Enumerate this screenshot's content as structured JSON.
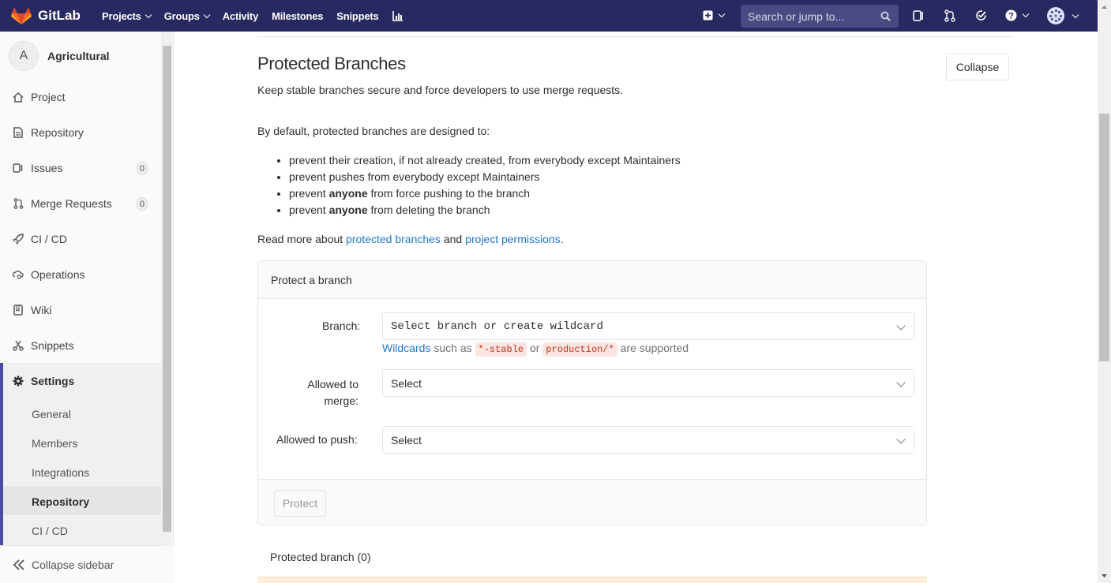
{
  "topnav": {
    "brand": "GitLab",
    "items": [
      {
        "label": "Projects",
        "caret": true
      },
      {
        "label": "Groups",
        "caret": true
      },
      {
        "label": "Activity",
        "caret": false
      },
      {
        "label": "Milestones",
        "caret": false
      },
      {
        "label": "Snippets",
        "caret": false
      }
    ],
    "search_placeholder": "Search or jump to...",
    "bg_color": "#292961"
  },
  "sidebar": {
    "project_initial": "A",
    "project_name": "Agricultural",
    "items": [
      {
        "label": "Project",
        "icon": "home-icon"
      },
      {
        "label": "Repository",
        "icon": "doc-icon"
      },
      {
        "label": "Issues",
        "icon": "issues-icon",
        "badge": "0"
      },
      {
        "label": "Merge Requests",
        "icon": "merge-request-icon",
        "badge": "0"
      },
      {
        "label": "CI / CD",
        "icon": "rocket-icon"
      },
      {
        "label": "Operations",
        "icon": "cloud-gear-icon"
      },
      {
        "label": "Wiki",
        "icon": "book-icon"
      },
      {
        "label": "Snippets",
        "icon": "scissors-icon"
      },
      {
        "label": "Settings",
        "icon": "gear-icon"
      }
    ],
    "settings_sub": [
      "General",
      "Members",
      "Integrations",
      "Repository",
      "CI / CD"
    ],
    "active_sub": "Repository",
    "collapse_label": "Collapse sidebar"
  },
  "main": {
    "title": "Protected Branches",
    "collapse_label": "Collapse",
    "description": "Keep stable branches secure and force developers to use merge requests.",
    "intro": "By default, protected branches are designed to:",
    "rules": [
      {
        "pre": "prevent their creation, if not already created, from everybody except Maintainers",
        "bold": "",
        "post": ""
      },
      {
        "pre": "prevent pushes from everybody except Maintainers",
        "bold": "",
        "post": ""
      },
      {
        "pre": "prevent ",
        "bold": "anyone",
        "post": " from force pushing to the branch"
      },
      {
        "pre": "prevent ",
        "bold": "anyone",
        "post": " from deleting the branch"
      }
    ],
    "readmore": {
      "pre": "Read more about ",
      "link1": "protected branches",
      "mid": " and ",
      "link2": "project permissions",
      "post": "."
    }
  },
  "form": {
    "header": "Protect a branch",
    "branch_label": "Branch:",
    "branch_value": "Select branch or create wildcard",
    "hint_link": "Wildcards",
    "hint_mid1": " such as ",
    "hint_code1": "*-stable",
    "hint_mid2": " or ",
    "hint_code2": "production/*",
    "hint_post": " are supported",
    "merge_label_1": "Allowed to",
    "merge_label_2": "merge:",
    "merge_value": "Select",
    "push_label": "Allowed to push:",
    "push_value": "Select",
    "protect_label": "Protect"
  },
  "protected_list": {
    "title": "Protected branch (0)"
  }
}
